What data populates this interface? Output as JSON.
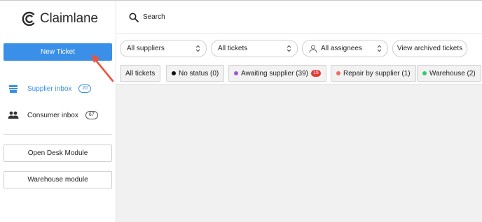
{
  "app": {
    "name": "Claimlane"
  },
  "sidebar": {
    "new_ticket_label": "New Ticket",
    "items": [
      {
        "label": "Supplier inbox",
        "count": "20",
        "icon": "store-icon",
        "active": true
      },
      {
        "label": "Consumer inbox",
        "count": "67",
        "icon": "people-icon",
        "active": false
      }
    ],
    "buttons": [
      {
        "label": "Open Desk Module"
      },
      {
        "label": "Warehouse module"
      }
    ]
  },
  "header": {
    "search_label": "Search"
  },
  "filters": {
    "suppliers": "All suppliers",
    "tickets": "All tickets",
    "assignees": "All assignees",
    "archived": "View archived tickets"
  },
  "status_tabs": [
    {
      "label": "All tickets"
    },
    {
      "label": "No status (0)",
      "dot_color": "#111111"
    },
    {
      "label": "Awaiting supplier (39)",
      "dot_color": "#9c59c9",
      "badge": "15"
    },
    {
      "label": "Repair by supplier (1)",
      "dot_color": "#ef6c5a"
    },
    {
      "label": "Warehouse (2)",
      "dot_color": "#2ecc71"
    }
  ],
  "colors": {
    "accent": "#3a8fe8",
    "annotation_arrow": "#e8553d",
    "badge": "#e53935"
  }
}
